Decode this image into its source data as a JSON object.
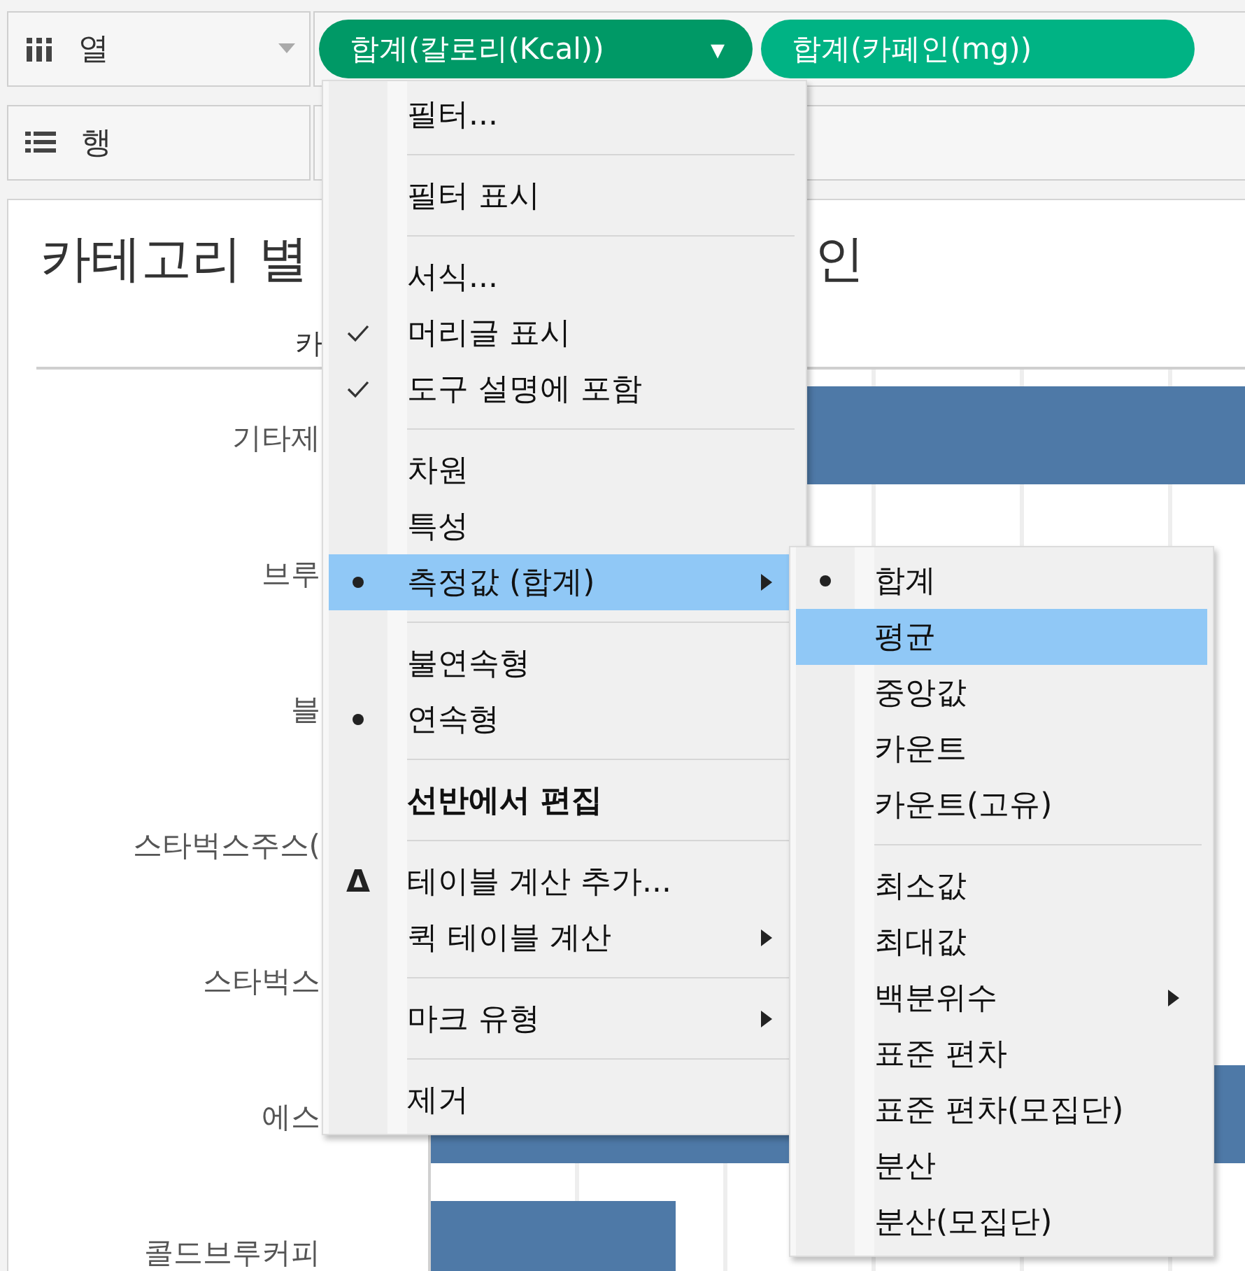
{
  "columns_shelf": {
    "label": "열",
    "pills": [
      {
        "label": "합계(칼로리(Kcal))",
        "selected": true,
        "caret": "▾"
      },
      {
        "label": "합계(카페인(mg))",
        "selected": false
      }
    ]
  },
  "rows_shelf": {
    "label": "행"
  },
  "chart": {
    "title_start": "카테고리 별",
    "title_end": "인",
    "column_header": "카",
    "rows": [
      {
        "label": "기타제"
      },
      {
        "label": "브루"
      },
      {
        "label": "블"
      },
      {
        "label": "스타벅스주스("
      },
      {
        "label": "스타벅스"
      },
      {
        "label": "에스"
      },
      {
        "label": "콜드브루커피"
      }
    ]
  },
  "context_menu": {
    "groups": [
      [
        {
          "label": "필터...",
          "checked": false,
          "selected": false,
          "highlighted": false,
          "submenu": false,
          "bold": false
        }
      ],
      [
        {
          "label": "필터 표시",
          "checked": false,
          "selected": false,
          "highlighted": false,
          "submenu": false,
          "bold": false
        }
      ],
      [
        {
          "label": "서식...",
          "checked": false,
          "selected": false,
          "highlighted": false,
          "submenu": false,
          "bold": false
        },
        {
          "label": "머리글 표시",
          "checked": true,
          "selected": false,
          "highlighted": false,
          "submenu": false,
          "bold": false
        },
        {
          "label": "도구 설명에 포함",
          "checked": true,
          "selected": false,
          "highlighted": false,
          "submenu": false,
          "bold": false
        }
      ],
      [
        {
          "label": "차원",
          "checked": false,
          "selected": false,
          "highlighted": false,
          "submenu": false,
          "bold": false
        },
        {
          "label": "특성",
          "checked": false,
          "selected": false,
          "highlighted": false,
          "submenu": false,
          "bold": false
        },
        {
          "label": "측정값 (합계)",
          "checked": false,
          "selected": true,
          "highlighted": true,
          "submenu": true,
          "bold": false
        }
      ],
      [
        {
          "label": "불연속형",
          "checked": false,
          "selected": false,
          "highlighted": false,
          "submenu": false,
          "bold": false
        },
        {
          "label": "연속형",
          "checked": false,
          "selected": true,
          "highlighted": false,
          "submenu": false,
          "bold": false
        }
      ],
      [
        {
          "label": "선반에서 편집",
          "checked": false,
          "selected": false,
          "highlighted": false,
          "submenu": false,
          "bold": true
        }
      ],
      [
        {
          "label": "테이블 계산 추가...",
          "symbol": "Δ",
          "checked": false,
          "selected": false,
          "highlighted": false,
          "submenu": false,
          "bold": false
        },
        {
          "label": "퀵 테이블 계산",
          "checked": false,
          "selected": false,
          "highlighted": false,
          "submenu": true,
          "bold": false
        }
      ],
      [
        {
          "label": "마크 유형",
          "checked": false,
          "selected": false,
          "highlighted": false,
          "submenu": true,
          "bold": false
        }
      ],
      [
        {
          "label": "제거",
          "checked": false,
          "selected": false,
          "highlighted": false,
          "submenu": false,
          "bold": false
        }
      ]
    ]
  },
  "submenu": {
    "groups": [
      [
        {
          "label": "합계",
          "checked": false,
          "selected": true,
          "highlighted": false,
          "submenu": false,
          "bold": false
        },
        {
          "label": "평균",
          "checked": false,
          "selected": false,
          "highlighted": true,
          "submenu": false,
          "bold": false
        },
        {
          "label": "중앙값",
          "checked": false,
          "selected": false,
          "highlighted": false,
          "submenu": false,
          "bold": false
        },
        {
          "label": "카운트",
          "checked": false,
          "selected": false,
          "highlighted": false,
          "submenu": false,
          "bold": false
        },
        {
          "label": "카운트(고유)",
          "checked": false,
          "selected": false,
          "highlighted": false,
          "submenu": false,
          "bold": false
        }
      ],
      [
        {
          "label": "최소값",
          "checked": false,
          "selected": false,
          "highlighted": false,
          "submenu": false,
          "bold": false
        },
        {
          "label": "최대값",
          "checked": false,
          "selected": false,
          "highlighted": false,
          "submenu": false,
          "bold": false
        },
        {
          "label": "백분위수",
          "checked": false,
          "selected": false,
          "highlighted": false,
          "submenu": true,
          "bold": false
        },
        {
          "label": "표준 편차",
          "checked": false,
          "selected": false,
          "highlighted": false,
          "submenu": false,
          "bold": false
        },
        {
          "label": "표준 편차(모집단)",
          "checked": false,
          "selected": false,
          "highlighted": false,
          "submenu": false,
          "bold": false
        },
        {
          "label": "분산",
          "checked": false,
          "selected": false,
          "highlighted": false,
          "submenu": false,
          "bold": false
        },
        {
          "label": "분산(모집단)",
          "checked": false,
          "selected": false,
          "highlighted": false,
          "submenu": false,
          "bold": false
        }
      ]
    ]
  }
}
